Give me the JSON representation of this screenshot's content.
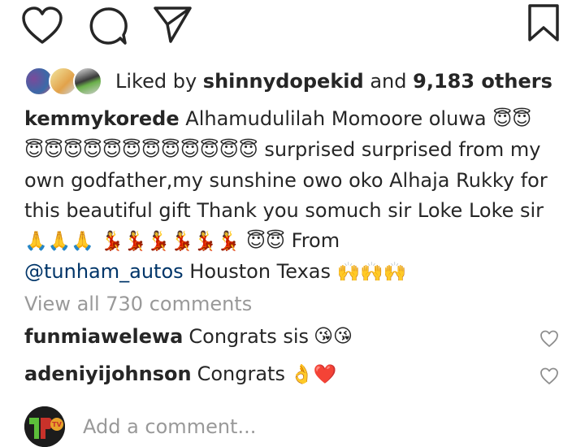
{
  "likes": {
    "prefix": "Liked by",
    "user": "shinnydopekid",
    "conjunction": "and",
    "count": "9,183 others"
  },
  "caption": {
    "username": "kemmykorede",
    "text_1": "Alhamudulilah  Momoore oluwa",
    "emoji_halo_2": "😇😇",
    "emoji_halo_12": "😇😇😇😇😇😇😇😇😇😇😇😇",
    "text_2": "surprised surprised from  my own godfather,my sunshine owo oko Alhaja Rukky for this  beautiful gift Thank you somuch sir Loke Loke sir",
    "emoji_pray": "🙏🙏🙏",
    "emoji_dancer": "💃💃💃💃💃💃",
    "emoji_halo_end": "😇😇",
    "text_3": "From",
    "mention": "@tunham_autos",
    "text_4": "Houston Texas",
    "emoji_hands": "🙌🙌🙌"
  },
  "view_all_comments": "View all 730 comments",
  "comments": [
    {
      "username": "funmiawelewa",
      "text": "Congrats sis",
      "emoji": "😘😘"
    },
    {
      "username": "adeniyijohnson",
      "text": "Congrats",
      "emoji": "👌❤️"
    }
  ],
  "add_comment": {
    "placeholder": "Add a comment..."
  },
  "self_avatar_letters": "TV",
  "icons": [
    "heart-icon",
    "comment-icon",
    "share-icon",
    "bookmark-icon"
  ],
  "colors": {
    "mention": "#003569",
    "muted": "#999999",
    "text": "#262626"
  }
}
